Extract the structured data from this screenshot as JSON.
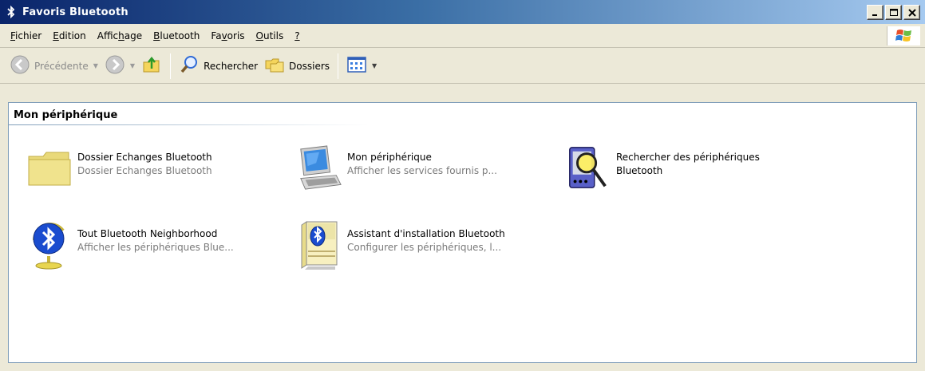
{
  "window": {
    "title": "Favoris Bluetooth"
  },
  "menu": [
    {
      "label": "Fichier",
      "accel": "F",
      "rest": "ichier"
    },
    {
      "label": "Edition",
      "accel": "E",
      "rest": "dition"
    },
    {
      "label": "Affichage",
      "pre": "Affic",
      "accel": "h",
      "rest": "age"
    },
    {
      "label": "Bluetooth",
      "accel": "B",
      "rest": "luetooth"
    },
    {
      "label": "Favoris",
      "pre": "Fa",
      "accel": "v",
      "rest": "oris"
    },
    {
      "label": "Outils",
      "accel": "O",
      "rest": "utils"
    },
    {
      "label": "?",
      "accel": "?",
      "rest": ""
    }
  ],
  "toolbar": {
    "back_label": "Précédente",
    "search_label": "Rechercher",
    "folders_label": "Dossiers"
  },
  "section": {
    "title": "Mon périphérique"
  },
  "items": [
    {
      "name": "Dossier Echanges Bluetooth",
      "desc": "Dossier Echanges Bluetooth",
      "icon": "folder-icon"
    },
    {
      "name": "Mon périphérique",
      "desc": "Afficher les services fournis p...",
      "icon": "computer-icon"
    },
    {
      "name": "Rechercher des périphériques",
      "name2": "Bluetooth",
      "desc": "",
      "icon": "device-search-icon"
    },
    {
      "name": "Tout Bluetooth Neighborhood",
      "desc": "Afficher les périphériques Blue...",
      "icon": "bluetooth-globe-icon"
    },
    {
      "name": "Assistant d'installation Bluetooth",
      "desc": "Configurer les périphériques, l...",
      "icon": "bluetooth-wizard-icon"
    }
  ],
  "colors": {
    "titlebar_start": "#0a246a",
    "titlebar_end": "#a6caf0",
    "chrome": "#ece9d8",
    "bluetooth_blue": "#1a4ccf"
  }
}
